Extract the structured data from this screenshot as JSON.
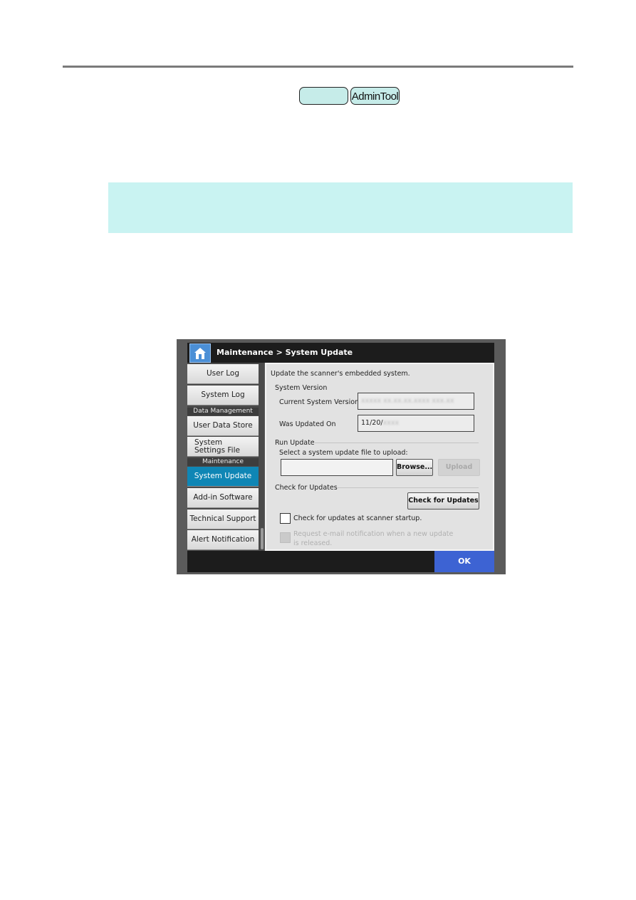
{
  "header": {
    "tags": [
      "",
      "AdminTool"
    ]
  },
  "screen": {
    "breadcrumb": "Maintenance > System Update",
    "sidebar": {
      "items": [
        {
          "label": "User Log",
          "type": "button"
        },
        {
          "label": "System Log",
          "type": "button"
        },
        {
          "label": "Data Management",
          "type": "header"
        },
        {
          "label": "User Data Store",
          "type": "button"
        },
        {
          "label": "System Settings File",
          "type": "button"
        },
        {
          "label": "Maintenance",
          "type": "header"
        },
        {
          "label": "System Update",
          "type": "button",
          "active": true
        },
        {
          "label": "Add-in Software",
          "type": "button"
        },
        {
          "label": "Technical Support",
          "type": "button"
        },
        {
          "label": "Alert Notification",
          "type": "button"
        }
      ]
    },
    "content": {
      "description": "Update the scanner's embedded system.",
      "system_version": {
        "heading": "System Version",
        "current_label": "Current System Version",
        "current_value": "xxxxx xx.xx.xx.xxxx xxx.xx",
        "updated_label": "Was Updated On",
        "updated_value_visible": "11/20/",
        "updated_value_blurred": "xxxx"
      },
      "run_update": {
        "heading": "Run Update",
        "select_label": "Select a system update file to upload:",
        "file_value": "",
        "browse_label": "Browse...",
        "upload_label": "Upload"
      },
      "check_updates": {
        "heading": "Check for Updates",
        "button_label": "Check for Updates",
        "startup_checkbox_label": "Check for updates at scanner startup.",
        "startup_checked": false,
        "email_checkbox_label": "Request e-mail notification when a new update is released.",
        "email_checked": false,
        "email_disabled": true
      }
    },
    "ok_label": "OK"
  },
  "colors": {
    "accent_active": "#0f86b5",
    "ok_button": "#3d63d3",
    "note_box": "#c9f3f2",
    "tag_fill": "#c6ece9"
  }
}
